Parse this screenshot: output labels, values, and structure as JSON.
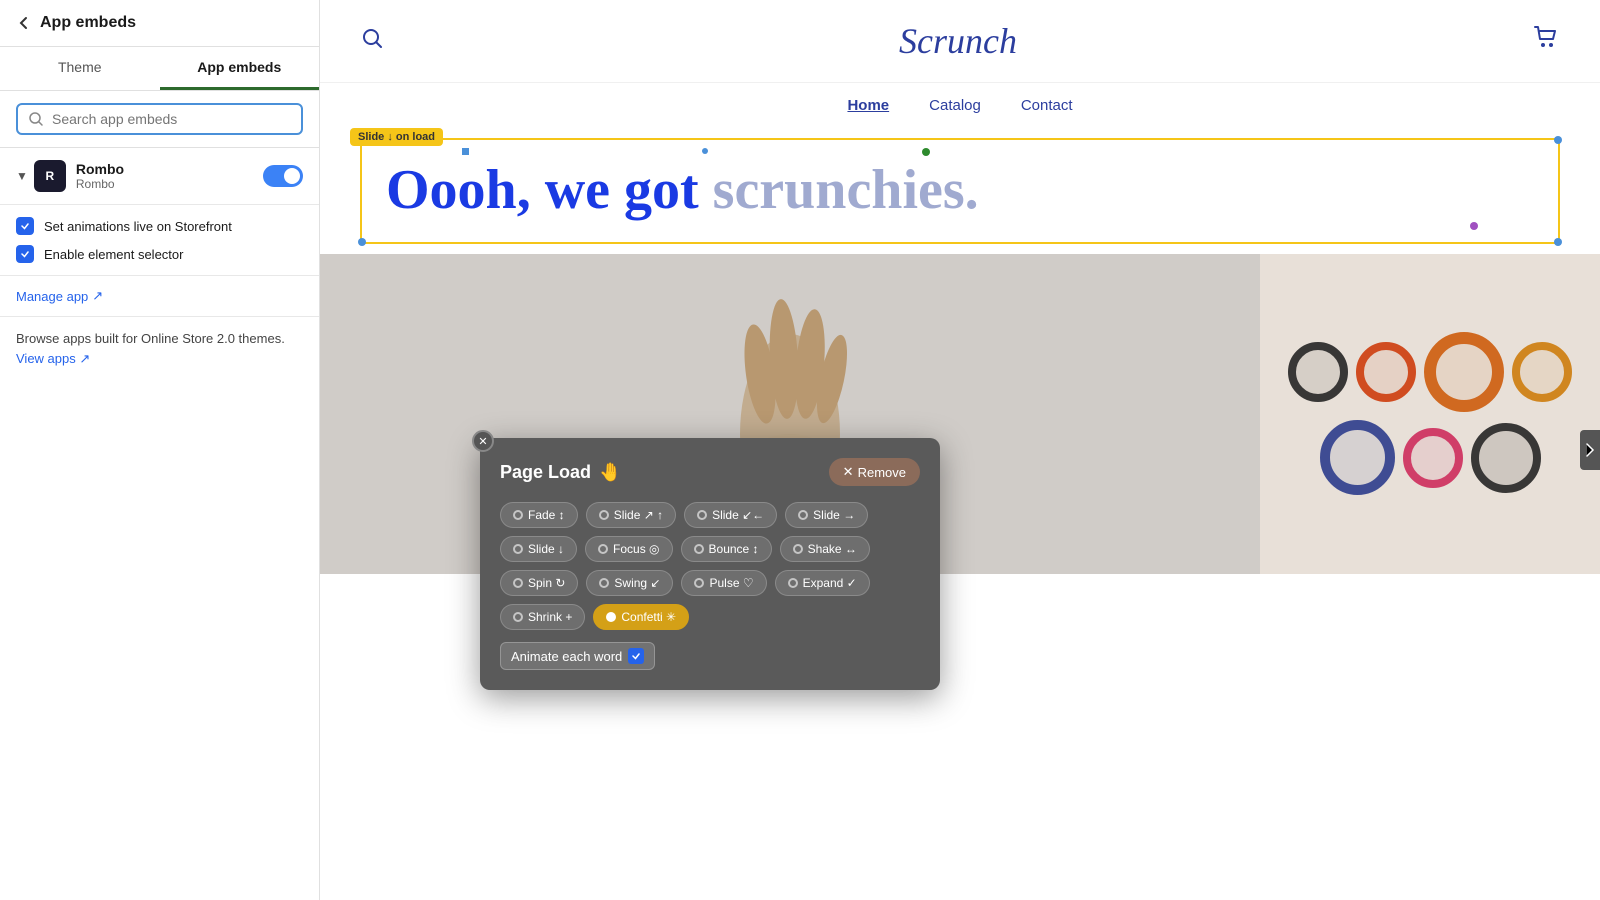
{
  "sidebar": {
    "header": {
      "back_label": "←",
      "title": "App embeds"
    },
    "tabs": [
      {
        "id": "theme",
        "label": "Theme",
        "active": false
      },
      {
        "id": "app-embeds",
        "label": "App embeds",
        "active": true
      }
    ],
    "search": {
      "placeholder": "Search app embeds",
      "value": ""
    },
    "app_embed": {
      "name": "Rombo",
      "subtitle": "Rombo",
      "toggle_on": true
    },
    "checkboxes": [
      {
        "id": "set-animations",
        "label": "Set animations live on Storefront",
        "checked": true
      },
      {
        "id": "enable-selector",
        "label": "Enable element selector",
        "checked": true
      }
    ],
    "manage_link": "Manage app",
    "browse_text": "Browse apps built for Online Store 2.0 themes.",
    "view_apps_link": "View apps"
  },
  "storefront": {
    "brand": "Scrunch",
    "nav_links": [
      {
        "label": "Home",
        "active": true
      },
      {
        "label": "Catalog",
        "active": false
      },
      {
        "label": "Contact",
        "active": false
      }
    ],
    "hero_headline": {
      "part1": "Oooh, we got",
      "part2": "scrunchies."
    },
    "slide_label": "Slide ↓ on load",
    "animation_modal": {
      "title": "Page Load",
      "emoji": "🤚",
      "remove_label": "Remove",
      "options": [
        {
          "id": "fade",
          "label": "Fade ↕",
          "selected": false
        },
        {
          "id": "slide-up",
          "label": "Slide ↗ ↑",
          "selected": false
        },
        {
          "id": "slide-left",
          "label": "Slide ↙← ",
          "selected": false
        },
        {
          "id": "slide-right",
          "label": "Slide →",
          "selected": false
        },
        {
          "id": "slide-down",
          "label": "Slide ↓",
          "selected": false
        },
        {
          "id": "focus",
          "label": "Focus ◎",
          "selected": false
        },
        {
          "id": "bounce",
          "label": "Bounce ↕",
          "selected": false
        },
        {
          "id": "shake",
          "label": "Shake ↔",
          "selected": false
        },
        {
          "id": "spin",
          "label": "Spin ↻",
          "selected": false
        },
        {
          "id": "swing",
          "label": "Swing ↙",
          "selected": false
        },
        {
          "id": "pulse",
          "label": "Pulse ♡",
          "selected": false
        },
        {
          "id": "expand",
          "label": "Expand ✓",
          "selected": false
        },
        {
          "id": "shrink",
          "label": "Shrink +",
          "selected": false
        },
        {
          "id": "confetti",
          "label": "Confetti ✳",
          "selected": true
        }
      ],
      "animate_each_word": {
        "label": "Animate each word",
        "checked": true
      }
    }
  },
  "colors": {
    "brand_blue": "#2c3e9e",
    "yellow_border": "#f5c518",
    "modal_bg": "#5a5a5a",
    "confetti_selected": "#d4a017",
    "remove_btn": "#8b6b5a",
    "scrunchies": [
      "#1a1a1a",
      "#d44000",
      "#c8580a",
      "#e88020",
      "#2244aa",
      "#cc3366",
      "#334488"
    ]
  }
}
